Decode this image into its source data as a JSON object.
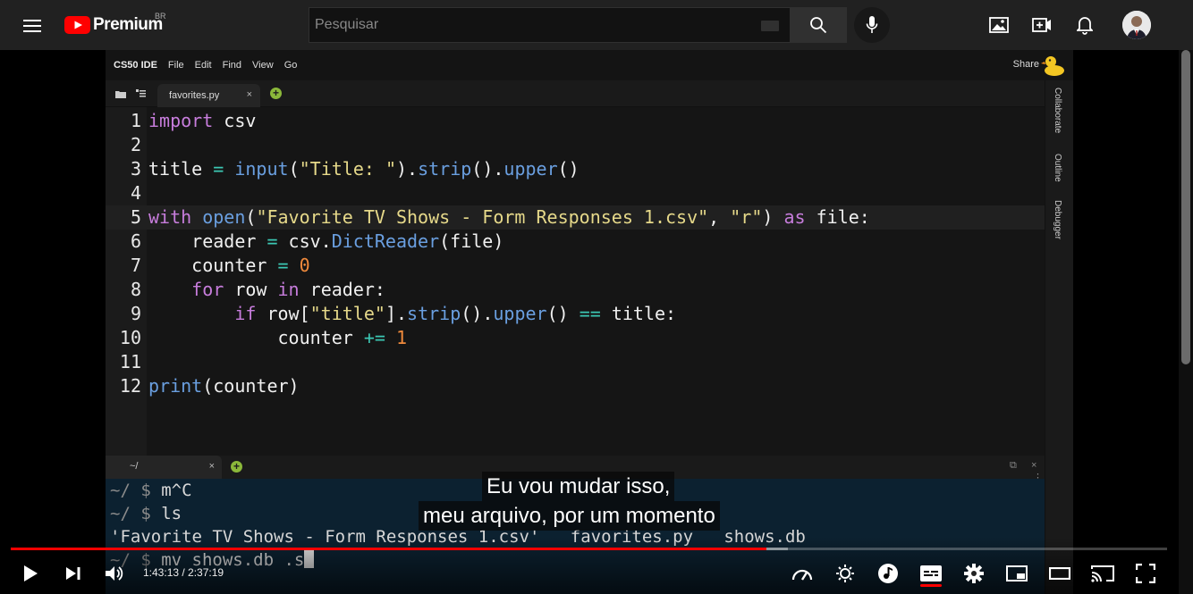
{
  "youtube": {
    "logo_text": "Premium",
    "country_code": "BR",
    "search_placeholder": "Pesquisar"
  },
  "ide": {
    "menu": [
      "CS50 IDE",
      "File",
      "Edit",
      "Find",
      "View",
      "Go"
    ],
    "share_label": "Share",
    "tab_label": "favorites.py",
    "tab_close": "×",
    "side_tabs": [
      "Collaborate",
      "Outline",
      "Debugger"
    ],
    "terminal_tab_label": "~/",
    "terminal_tab_close": "×",
    "terminal_ctl_restore": "⧉",
    "terminal_ctl_close": "×",
    "terminal_ctl_dots": "⋮"
  },
  "code_lines": [
    {
      "n": "1",
      "tokens": [
        [
          "kw",
          "import"
        ],
        [
          "p",
          " csv"
        ]
      ]
    },
    {
      "n": "2",
      "tokens": []
    },
    {
      "n": "3",
      "tokens": [
        [
          "p",
          "title "
        ],
        [
          "op",
          "="
        ],
        [
          "p",
          " "
        ],
        [
          "fn",
          "input"
        ],
        [
          "p",
          "("
        ],
        [
          "str",
          "\"Title: \""
        ],
        [
          "p",
          ")."
        ],
        [
          "fn",
          "strip"
        ],
        [
          "p",
          "()."
        ],
        [
          "fn",
          "upper"
        ],
        [
          "p",
          "()"
        ]
      ]
    },
    {
      "n": "4",
      "tokens": []
    },
    {
      "n": "5",
      "tokens": [
        [
          "kw",
          "with"
        ],
        [
          "p",
          " "
        ],
        [
          "fn",
          "open"
        ],
        [
          "p",
          "("
        ],
        [
          "str",
          "\"Favorite TV Shows - Form Responses 1.csv\""
        ],
        [
          "p",
          ", "
        ],
        [
          "str",
          "\"r\""
        ],
        [
          "p",
          ") "
        ],
        [
          "kw",
          "as"
        ],
        [
          "p",
          " file:"
        ]
      ]
    },
    {
      "n": "6",
      "tokens": [
        [
          "p",
          "    reader "
        ],
        [
          "op",
          "="
        ],
        [
          "p",
          " csv."
        ],
        [
          "fn",
          "DictReader"
        ],
        [
          "p",
          "(file)"
        ]
      ]
    },
    {
      "n": "7",
      "tokens": [
        [
          "p",
          "    counter "
        ],
        [
          "op",
          "="
        ],
        [
          "p",
          " "
        ],
        [
          "num",
          "0"
        ]
      ]
    },
    {
      "n": "8",
      "tokens": [
        [
          "p",
          "    "
        ],
        [
          "kw",
          "for"
        ],
        [
          "p",
          " row "
        ],
        [
          "kw",
          "in"
        ],
        [
          "p",
          " reader:"
        ]
      ]
    },
    {
      "n": "9",
      "tokens": [
        [
          "p",
          "        "
        ],
        [
          "kw",
          "if"
        ],
        [
          "p",
          " row["
        ],
        [
          "str",
          "\"title\""
        ],
        [
          "p",
          "]."
        ],
        [
          "fn",
          "strip"
        ],
        [
          "p",
          "()."
        ],
        [
          "fn",
          "upper"
        ],
        [
          "p",
          "() "
        ],
        [
          "op",
          "=="
        ],
        [
          "p",
          " title:"
        ]
      ]
    },
    {
      "n": "10",
      "tokens": [
        [
          "p",
          "            counter "
        ],
        [
          "op",
          "+="
        ],
        [
          "p",
          " "
        ],
        [
          "num",
          "1"
        ]
      ]
    },
    {
      "n": "11",
      "tokens": []
    },
    {
      "n": "12",
      "tokens": [
        [
          "fn",
          "print"
        ],
        [
          "p",
          "(counter)"
        ]
      ]
    }
  ],
  "terminal_lines": [
    {
      "prompt": "~/ $ ",
      "text": "m^C"
    },
    {
      "prompt": "~/ $ ",
      "text": "ls"
    },
    {
      "prompt": "",
      "text": "'Favorite TV Shows - Form Responses 1.csv'   favorites.py   shows.db"
    },
    {
      "prompt": "~/ $ ",
      "text": "mv shows.db .s"
    }
  ],
  "captions": [
    "Eu vou mudar isso,",
    "meu arquivo, por um momento"
  ],
  "player": {
    "time_display": "1:43:13 / 2:37:19",
    "played_fraction": 0.6535,
    "loaded_fraction": 0.672
  },
  "colors": {
    "youtube_red": "#ff0000",
    "keyword": "#c77ddc",
    "function": "#6a9fe0",
    "string": "#e6d98a",
    "number": "#f08a3c",
    "operator": "#3cc8b4"
  }
}
